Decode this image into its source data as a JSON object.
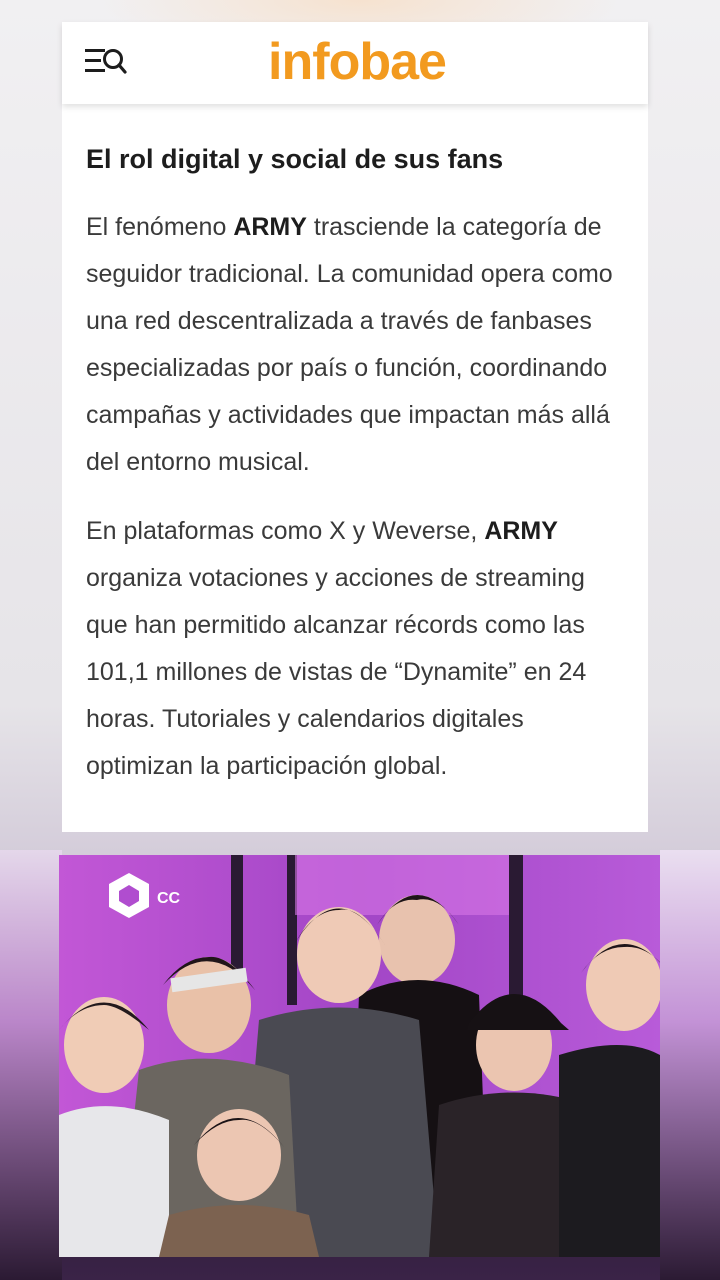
{
  "header": {
    "logo_text": "infobae",
    "menu_icon": "menu-search-icon"
  },
  "article": {
    "heading": "El rol digital y social de sus fans",
    "paragraph1": {
      "before": "El fenómeno ",
      "bold": "ARMY",
      "after": " trasciende la categoría de seguidor tradicional. La comunidad opera como una red descentralizada a través de fanbases especializadas por país o función, coordinando campañas y actividades que impactan más allá del entorno musical."
    },
    "paragraph2": {
      "before": "En plataformas como X y Weverse, ",
      "bold": "ARMY",
      "after": " organiza votaciones y acciones de streaming que han permitido alcanzar récords como las 101,1 millones de vistas de “Dynamite” en 24 horas. Tutoriales y calendarios digitales optimizan la participación global."
    }
  },
  "image": {
    "watermark_label": "CC",
    "watermark_icon": "cube-logo-icon"
  },
  "colors": {
    "brand": "#f29a1f",
    "photo_background": "#b24fd0"
  }
}
